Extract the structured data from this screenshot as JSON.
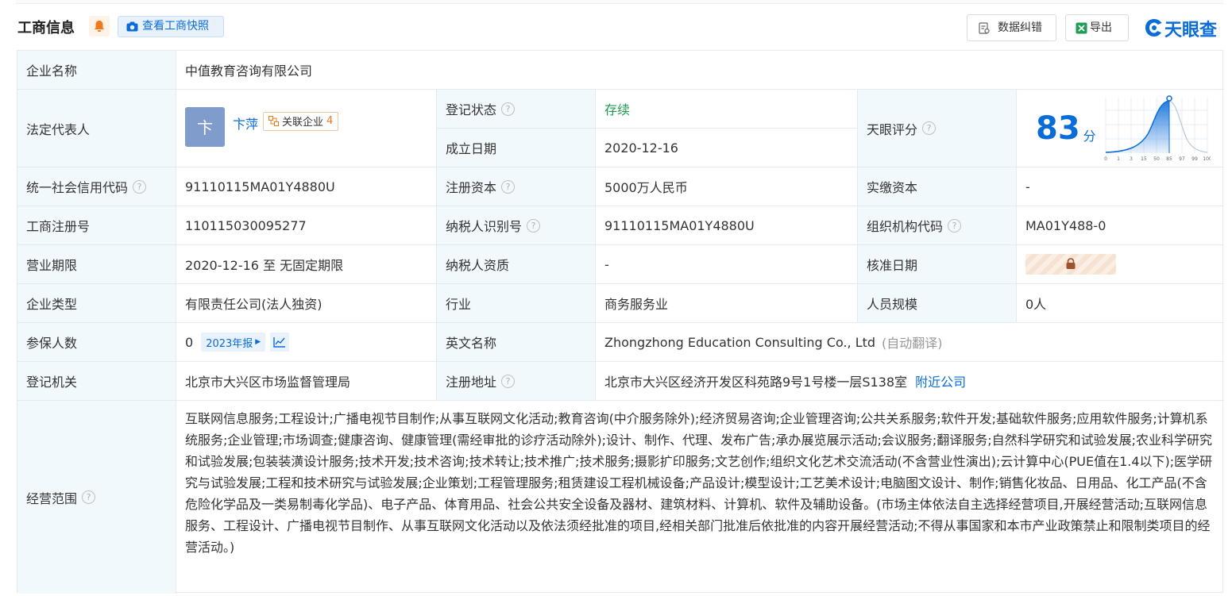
{
  "header": {
    "title": "工商信息",
    "snapshot_label": "查看工商快照",
    "correct_label": "数据纠错",
    "export_label": "导出",
    "logo_text": "天眼查",
    "accent": "#0a6cd8"
  },
  "company": {
    "name_label": "企业名称",
    "name": "中值教育咨询有限公司",
    "rep_label": "法定代表人",
    "rep_avatar": "卞",
    "rep_name": "卞萍",
    "assoc_label": "关联企业",
    "assoc_count": "4",
    "status_label": "登记状态",
    "status": "存续",
    "founded_label": "成立日期",
    "founded": "2020-12-16",
    "score_label": "天眼评分",
    "score": "83",
    "score_unit": "分",
    "score_ticks": [
      "0",
      "1",
      "3",
      "15",
      "50",
      "85",
      "97",
      "99",
      "100"
    ],
    "credit_label": "统一社会信用代码",
    "credit": "91110115MA01Y4880U",
    "capital_label": "注册资本",
    "capital": "5000万人民币",
    "paid_label": "实缴资本",
    "paid": "-",
    "reg_no_label": "工商注册号",
    "reg_no": "110115030095277",
    "tax_id_label": "纳税人识别号",
    "tax_id": "91110115MA01Y4880U",
    "org_code_label": "组织机构代码",
    "org_code": "MA01Y488-0",
    "term_label": "营业期限",
    "term": "2020-12-16 至 无固定期限",
    "taxpayer_label": "纳税人资质",
    "taxpayer": "-",
    "approve_label": "核准日期",
    "type_label": "企业类型",
    "type": "有限责任公司(法人独资)",
    "industry_label": "行业",
    "industry": "商务服务业",
    "staff_label": "人员规模",
    "staff": "0人",
    "insured_label": "参保人数",
    "insured": "0",
    "insured_report": "2023年报",
    "en_name_label": "英文名称",
    "en_name": "Zhongzhong Education Consulting Co., Ltd",
    "en_name_note": "(自动翻译)",
    "authority_label": "登记机关",
    "authority": "北京市大兴区市场监督管理局",
    "address_label": "注册地址",
    "address": "北京市大兴区经济开发区科苑路9号1号楼一层S138室",
    "nearby_label": "附近公司",
    "scope_label": "经营范围",
    "scope": "互联网信息服务;工程设计;广播电视节目制作;从事互联网文化活动;教育咨询(中介服务除外);经济贸易咨询;企业管理咨询;公共关系服务;软件开发;基础软件服务;应用软件服务;计算机系统服务;企业管理;市场调查;健康咨询、健康管理(需经审批的诊疗活动除外);设计、制作、代理、发布广告;承办展览展示活动;会议服务;翻译服务;自然科学研究和试验发展;农业科学研究和试验发展;包装装潢设计服务;技术开发;技术咨询;技术转让;技术推广;技术服务;摄影扩印服务;文艺创作;组织文化艺术交流活动(不含营业性演出);云计算中心(PUE值在1.4以下);医学研究与试验发展;工程和技术研究与试验发展;企业策划;工程管理服务;租赁建设工程机械设备;产品设计;模型设计;工艺美术设计;电脑图文设计、制作;销售化妆品、日用品、化工产品(不含危险化学品及一类易制毒化学品)、电子产品、体育用品、社会公共安全设备及器材、建筑材料、计算机、软件及辅助设备。(市场主体依法自主选择经营项目,开展经营活动;互联网信息服务、工程设计、广播电视节目制作、从事互联网文化活动以及依法须经批准的项目,经相关部门批准后依批准的内容开展经营活动;不得从事国家和本市产业政策禁止和限制类项目的经营活动。)"
  }
}
